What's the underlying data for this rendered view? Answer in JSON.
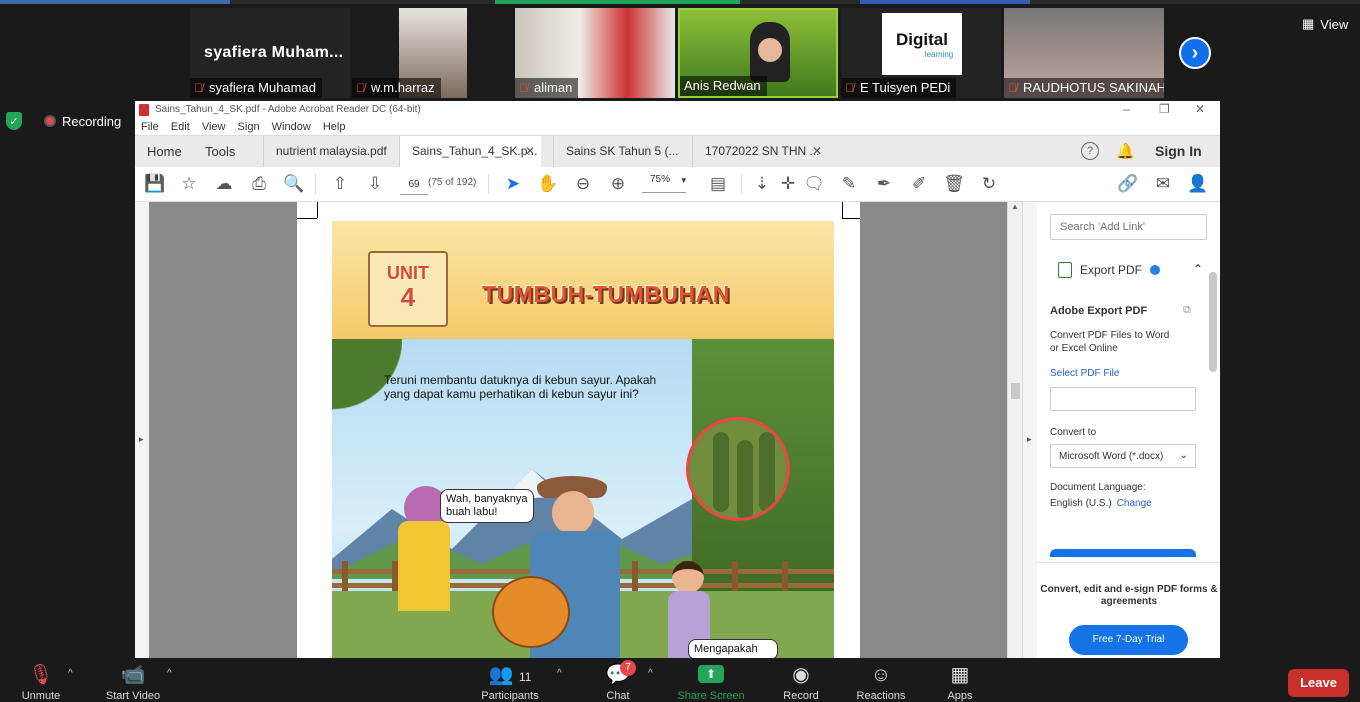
{
  "zoom": {
    "participants_strip": [
      {
        "big_name": "syafiera  Muham...",
        "name": "syafiera Muhamad",
        "muted": true
      },
      {
        "big_name": "",
        "name": "w.m.harraz",
        "muted": true
      },
      {
        "big_name": "",
        "name": "aliman",
        "muted": true
      },
      {
        "big_name": "",
        "name": "Anis Redwan",
        "muted": false
      },
      {
        "big_name": "",
        "name": "E Tuisyen PEDi",
        "muted": true,
        "logo_text": "Digital",
        "logo_sub": "learning"
      },
      {
        "big_name": "",
        "name": "RAUDHOTUS SAKINAH",
        "muted": true
      }
    ],
    "view_label": "View",
    "recording_label": "Recording",
    "bottom": {
      "unmute": "Unmute",
      "start_video": "Start Video",
      "participants": "Participants",
      "participants_count": "11",
      "chat": "Chat",
      "chat_badge": "7",
      "share_screen": "Share Screen",
      "record": "Record",
      "reactions": "Reactions",
      "apps": "Apps",
      "leave": "Leave"
    }
  },
  "acrobat": {
    "window_title": "Sains_Tahun_4_SK.pdf - Adobe Acrobat Reader DC (64-bit)",
    "menu": [
      "File",
      "Edit",
      "View",
      "Sign",
      "Window",
      "Help"
    ],
    "nav": {
      "home": "Home",
      "tools": "Tools"
    },
    "tabs": [
      {
        "label": "nutrient malaysia.pdf",
        "closable": false
      },
      {
        "label": "Sains_Tahun_4_SK.p...",
        "closable": true,
        "active": true
      },
      {
        "label": "Sains SK Tahun 5 (...",
        "closable": false
      },
      {
        "label": "17072022 SN THN ...",
        "closable": true
      }
    ],
    "sign_in": "Sign In",
    "page_number": "69",
    "page_count": "(75 of 192)",
    "zoom_level": "75%",
    "page": {
      "unit_word": "UNIT",
      "unit_number": "4",
      "chapter_title": "TUMBUH-TUMBUHAN",
      "intro": "Teruni membantu datuknya di kebun sayur. Apakah yang dapat kamu perhatikan di kebun sayur ini?",
      "bubble1": "Wah, banyaknya buah labu!",
      "bubble2": "Mengapakah"
    },
    "right_pane": {
      "search_placeholder": "Search 'Add Link'",
      "export_title": "Export PDF",
      "heading": "Adobe Export PDF",
      "description": "Convert PDF Files to Word or Excel Online",
      "select_file": "Select PDF File",
      "convert_to": "Convert to",
      "convert_option": "Microsoft Word (*.docx)",
      "doc_language_label": "Document Language:",
      "doc_language": "English (U.S.)",
      "change": "Change",
      "promo": "Convert, edit and e-sign PDF forms & agreements",
      "trial": "Free 7-Day Trial"
    }
  },
  "colors": {
    "zoom_bg": "#1a1a1a",
    "zoom_blue": "#0e71eb",
    "leave_red": "#c9302c",
    "acrobat_blue": "#1473e6",
    "share_green": "#23a559"
  }
}
